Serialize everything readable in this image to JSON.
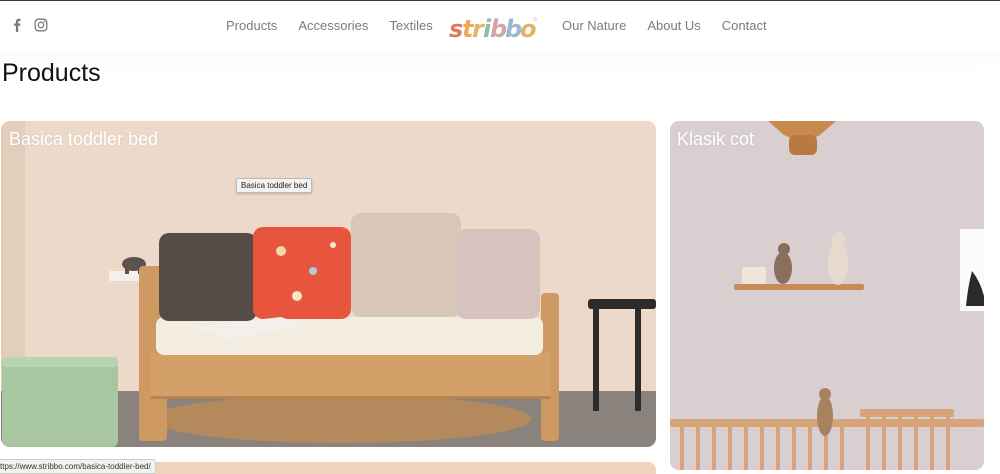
{
  "header": {
    "nav_left": [
      "Products",
      "Accessories",
      "Textiles"
    ],
    "nav_right": [
      "Our Nature",
      "About Us",
      "Contact"
    ],
    "logo_text": "stribbo",
    "social_icons": [
      "facebook-icon",
      "instagram-icon"
    ]
  },
  "main": {
    "page_title": "Products",
    "cards": [
      {
        "label": "Basica toddler bed"
      },
      {
        "label": "Klasik cot"
      }
    ]
  },
  "tooltip": {
    "text": "Basica toddler bed"
  },
  "status_bar": {
    "url": "ttps://www.stribbo.com/basica-toddler-bed/"
  },
  "colors": {
    "nav_text": "#7b7b7b",
    "logo_s": "#e07a5f",
    "logo_t": "#f2a65a",
    "logo_r": "#e4b363",
    "logo_i": "#8fb9a8",
    "logo_b": "#d4a5a5",
    "logo_o": "#9ab7d3"
  }
}
